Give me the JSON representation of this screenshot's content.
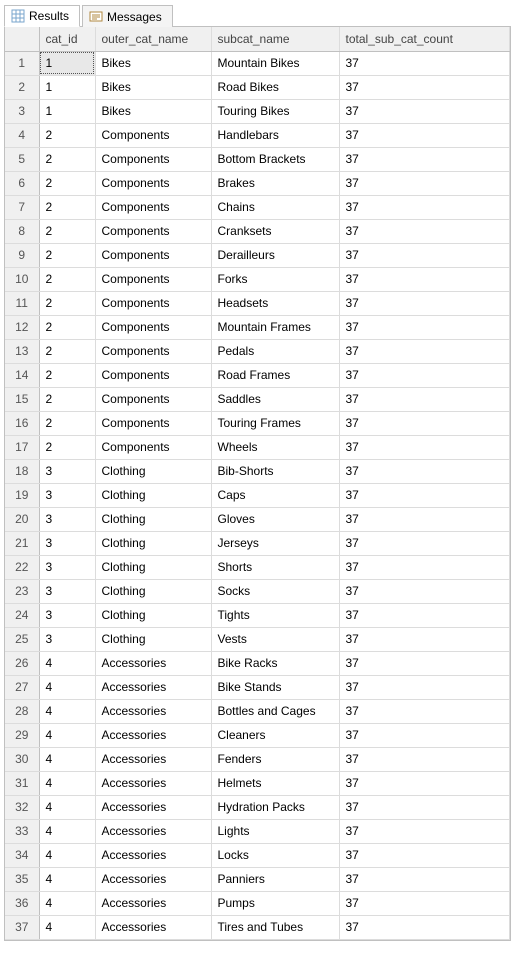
{
  "tabs": {
    "results": "Results",
    "messages": "Messages"
  },
  "grid": {
    "headers": {
      "rownum": "",
      "cat_id": "cat_id",
      "outer_cat_name": "outer_cat_name",
      "subcat_name": "subcat_name",
      "total_sub_cat_count": "total_sub_cat_count"
    },
    "rows": [
      {
        "n": "1",
        "cat_id": "1",
        "outer": "Bikes",
        "sub": "Mountain Bikes",
        "total": "37"
      },
      {
        "n": "2",
        "cat_id": "1",
        "outer": "Bikes",
        "sub": "Road Bikes",
        "total": "37"
      },
      {
        "n": "3",
        "cat_id": "1",
        "outer": "Bikes",
        "sub": "Touring Bikes",
        "total": "37"
      },
      {
        "n": "4",
        "cat_id": "2",
        "outer": "Components",
        "sub": "Handlebars",
        "total": "37"
      },
      {
        "n": "5",
        "cat_id": "2",
        "outer": "Components",
        "sub": "Bottom Brackets",
        "total": "37"
      },
      {
        "n": "6",
        "cat_id": "2",
        "outer": "Components",
        "sub": "Brakes",
        "total": "37"
      },
      {
        "n": "7",
        "cat_id": "2",
        "outer": "Components",
        "sub": "Chains",
        "total": "37"
      },
      {
        "n": "8",
        "cat_id": "2",
        "outer": "Components",
        "sub": "Cranksets",
        "total": "37"
      },
      {
        "n": "9",
        "cat_id": "2",
        "outer": "Components",
        "sub": "Derailleurs",
        "total": "37"
      },
      {
        "n": "10",
        "cat_id": "2",
        "outer": "Components",
        "sub": "Forks",
        "total": "37"
      },
      {
        "n": "11",
        "cat_id": "2",
        "outer": "Components",
        "sub": "Headsets",
        "total": "37"
      },
      {
        "n": "12",
        "cat_id": "2",
        "outer": "Components",
        "sub": "Mountain Frames",
        "total": "37"
      },
      {
        "n": "13",
        "cat_id": "2",
        "outer": "Components",
        "sub": "Pedals",
        "total": "37"
      },
      {
        "n": "14",
        "cat_id": "2",
        "outer": "Components",
        "sub": "Road Frames",
        "total": "37"
      },
      {
        "n": "15",
        "cat_id": "2",
        "outer": "Components",
        "sub": "Saddles",
        "total": "37"
      },
      {
        "n": "16",
        "cat_id": "2",
        "outer": "Components",
        "sub": "Touring Frames",
        "total": "37"
      },
      {
        "n": "17",
        "cat_id": "2",
        "outer": "Components",
        "sub": "Wheels",
        "total": "37"
      },
      {
        "n": "18",
        "cat_id": "3",
        "outer": "Clothing",
        "sub": "Bib-Shorts",
        "total": "37"
      },
      {
        "n": "19",
        "cat_id": "3",
        "outer": "Clothing",
        "sub": "Caps",
        "total": "37"
      },
      {
        "n": "20",
        "cat_id": "3",
        "outer": "Clothing",
        "sub": "Gloves",
        "total": "37"
      },
      {
        "n": "21",
        "cat_id": "3",
        "outer": "Clothing",
        "sub": "Jerseys",
        "total": "37"
      },
      {
        "n": "22",
        "cat_id": "3",
        "outer": "Clothing",
        "sub": "Shorts",
        "total": "37"
      },
      {
        "n": "23",
        "cat_id": "3",
        "outer": "Clothing",
        "sub": "Socks",
        "total": "37"
      },
      {
        "n": "24",
        "cat_id": "3",
        "outer": "Clothing",
        "sub": "Tights",
        "total": "37"
      },
      {
        "n": "25",
        "cat_id": "3",
        "outer": "Clothing",
        "sub": "Vests",
        "total": "37"
      },
      {
        "n": "26",
        "cat_id": "4",
        "outer": "Accessories",
        "sub": "Bike Racks",
        "total": "37"
      },
      {
        "n": "27",
        "cat_id": "4",
        "outer": "Accessories",
        "sub": "Bike Stands",
        "total": "37"
      },
      {
        "n": "28",
        "cat_id": "4",
        "outer": "Accessories",
        "sub": "Bottles and Cages",
        "total": "37"
      },
      {
        "n": "29",
        "cat_id": "4",
        "outer": "Accessories",
        "sub": "Cleaners",
        "total": "37"
      },
      {
        "n": "30",
        "cat_id": "4",
        "outer": "Accessories",
        "sub": "Fenders",
        "total": "37"
      },
      {
        "n": "31",
        "cat_id": "4",
        "outer": "Accessories",
        "sub": "Helmets",
        "total": "37"
      },
      {
        "n": "32",
        "cat_id": "4",
        "outer": "Accessories",
        "sub": "Hydration Packs",
        "total": "37"
      },
      {
        "n": "33",
        "cat_id": "4",
        "outer": "Accessories",
        "sub": "Lights",
        "total": "37"
      },
      {
        "n": "34",
        "cat_id": "4",
        "outer": "Accessories",
        "sub": "Locks",
        "total": "37"
      },
      {
        "n": "35",
        "cat_id": "4",
        "outer": "Accessories",
        "sub": "Panniers",
        "total": "37"
      },
      {
        "n": "36",
        "cat_id": "4",
        "outer": "Accessories",
        "sub": "Pumps",
        "total": "37"
      },
      {
        "n": "37",
        "cat_id": "4",
        "outer": "Accessories",
        "sub": "Tires and Tubes",
        "total": "37"
      }
    ],
    "selected_row": 0,
    "selected_col": "cat_id"
  }
}
